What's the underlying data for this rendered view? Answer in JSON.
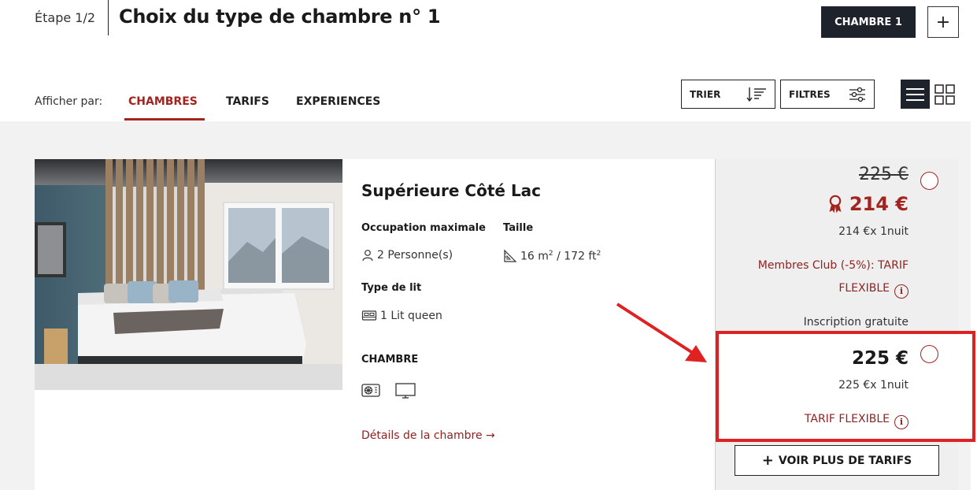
{
  "header": {
    "step": "Étape 1/2",
    "title": "Choix du type de chambre n° 1",
    "room_tab": "CHAMBRE 1",
    "add_room": "+"
  },
  "display": {
    "show_by_label": "Afficher par:",
    "tabs": [
      {
        "label": "CHAMBRES",
        "active": true
      },
      {
        "label": "TARIFS",
        "active": false
      },
      {
        "label": "EXPERIENCES",
        "active": false
      }
    ],
    "sort_label": "TRIER",
    "filters_label": "FILTRES"
  },
  "room": {
    "name": "Supérieure Côté Lac",
    "occupancy_label": "Occupation maximale",
    "occupancy_value": "2 Personne(s)",
    "size_label": "Taille",
    "size_value_m2": "16 m",
    "size_sup_1": "2",
    "size_value_ft2": " / 172 ft",
    "size_sup_2": "2",
    "bed_type_label": "Type de lit",
    "bed_type_value": "1 Lit queen",
    "amenities_label": "CHAMBRE",
    "amenities": [
      "air-conditioning-icon",
      "tv-icon"
    ],
    "details_link": "Détails de la chambre →"
  },
  "rates": {
    "member": {
      "old_price": "225 €",
      "price": "214 €",
      "per_night": "214 €x 1nuit",
      "name_line1": "Membres Club (-5%): TARIF",
      "name_line2": "FLEXIBLE",
      "note": "Inscription gratuite"
    },
    "standard": {
      "price": "225 €",
      "per_night": "225 €x 1nuit",
      "name": "TARIF FLEXIBLE"
    },
    "info_glyph": "i",
    "more_rates": "VOIR PLUS DE TARIFS",
    "more_rates_icon": "+"
  },
  "colors": {
    "accent": "#a3231f",
    "dark": "#1e232b",
    "highlight": "#e02121",
    "panel_bg": "#efefef"
  }
}
